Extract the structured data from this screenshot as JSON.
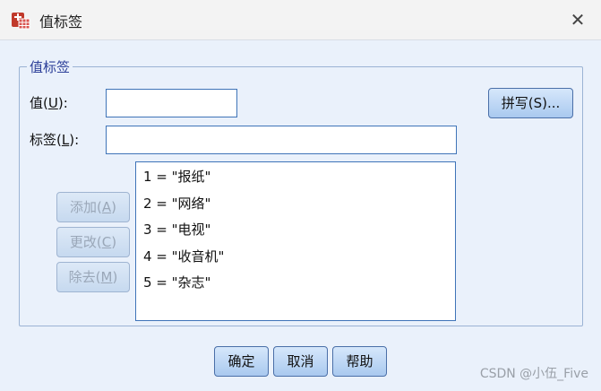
{
  "window": {
    "title": "值标签",
    "close_glyph": "✕"
  },
  "group": {
    "legend": "值标签"
  },
  "value_field": {
    "label_pre": "值(",
    "label_key": "U",
    "label_post": "):",
    "value": ""
  },
  "label_field": {
    "label_pre": "标签(",
    "label_key": "L",
    "label_post": "):",
    "value": ""
  },
  "buttons": {
    "spell": "拼写(S)...",
    "add_pre": "添加(",
    "add_key": "A",
    "add_post": ")",
    "change_pre": "更改(",
    "change_key": "C",
    "change_post": ")",
    "remove_pre": "除去(",
    "remove_key": "M",
    "remove_post": ")",
    "ok": "确定",
    "cancel": "取消",
    "help": "帮助"
  },
  "labels_list": [
    "1 = \"报纸\"",
    "2 = \"网络\"",
    "3 = \"电视\"",
    "4 = \"收音机\"",
    "5 = \"杂志\""
  ],
  "watermark": "CSDN @小伍_Five",
  "colors": {
    "accent_border": "#3f74b8",
    "group_title": "#2c3f99",
    "dialog_bg": "#eaf1fb"
  }
}
